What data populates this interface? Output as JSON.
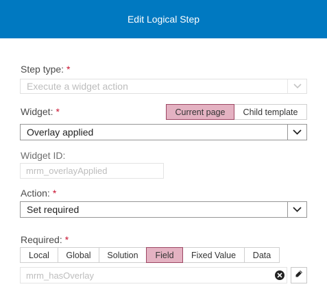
{
  "dialog": {
    "title": "Edit Logical Step"
  },
  "step_type": {
    "label": "Step type:",
    "required_mark": "*",
    "value": "Execute a widget action",
    "icon": "chevron-down-icon"
  },
  "widget": {
    "label": "Widget:",
    "required_mark": "*",
    "scope_buttons": [
      {
        "label": "Current page",
        "active": true
      },
      {
        "label": "Child template",
        "active": false
      }
    ],
    "value": "Overlay applied",
    "icon": "chevron-down-icon"
  },
  "widget_id": {
    "label": "Widget ID:",
    "value": "mrm_overlayApplied"
  },
  "action": {
    "label": "Action:",
    "required_mark": "*",
    "value": "Set required",
    "icon": "chevron-down-icon"
  },
  "required": {
    "label": "Required:",
    "required_mark": "*",
    "source_buttons": [
      {
        "label": "Local",
        "active": false
      },
      {
        "label": "Global",
        "active": false
      },
      {
        "label": "Solution",
        "active": false
      },
      {
        "label": "Field",
        "active": true
      },
      {
        "label": "Fixed Value",
        "active": false
      },
      {
        "label": "Data",
        "active": false
      }
    ],
    "field_value": "mrm_hasOverlay",
    "clear_icon": "clear-circle-icon",
    "edit_icon": "pencil-icon"
  },
  "colors": {
    "header_bg": "#0079c1",
    "required_star": "#c8102e",
    "active_toggle_bg": "#e4b2c2",
    "active_toggle_border": "#9c4562"
  }
}
